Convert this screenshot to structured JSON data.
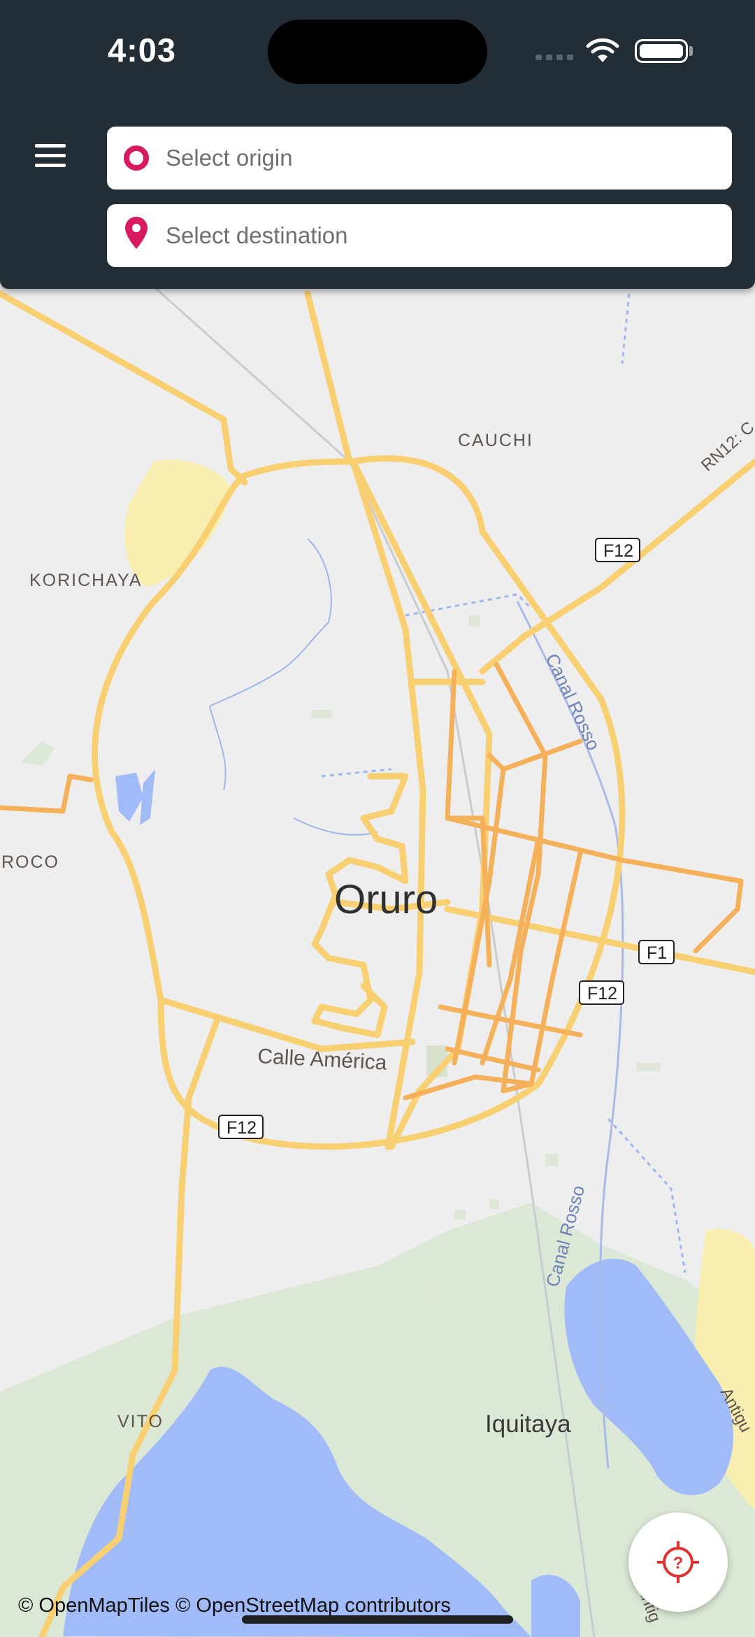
{
  "status_bar": {
    "time": "4:03"
  },
  "search": {
    "origin_placeholder": "Select origin",
    "destination_placeholder": "Select destination"
  },
  "map": {
    "city_label": "Oruro",
    "places": [
      "CAUCHI",
      "KORICHAYA",
      "ROCO",
      "VITO",
      "Iquitaya"
    ],
    "streets": [
      "Calle América",
      "Canal Rosso",
      "Canal Rosso",
      "RN12: C",
      "Antigu",
      "Antig"
    ],
    "road_shields": [
      "F12",
      "F1",
      "F12",
      "F12"
    ],
    "attribution": "© OpenMapTiles © OpenStreetMap contributors"
  },
  "icons": {
    "menu": "hamburger-menu-icon",
    "origin": "origin-ring-icon",
    "destination": "map-pin-icon",
    "locate": "locate-crosshair-question-icon"
  },
  "colors": {
    "header_bg": "#232d35",
    "accent": "#d81b60",
    "major_road": "#f8cf71",
    "primary_road": "#f5b05a",
    "water": "#a0bbf8",
    "land_green": "#dbe8d5",
    "sand": "#f8eeb0",
    "background": "#eeeeee"
  }
}
